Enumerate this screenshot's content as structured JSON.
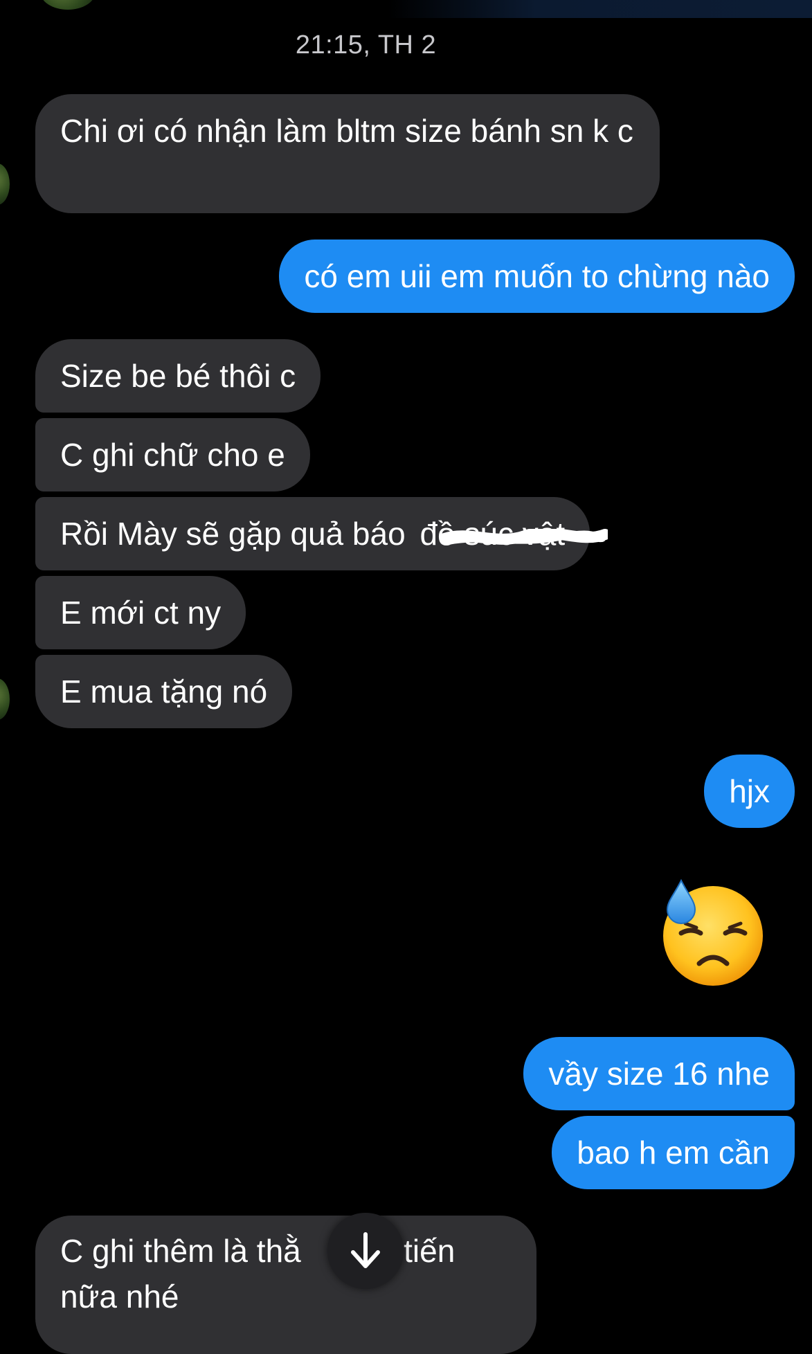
{
  "thread": {
    "timestamp": "21:15, TH 2"
  },
  "messages": [
    {
      "side": "incoming",
      "text": "Chi ơi có nhận làm bltm size bánh sn k c"
    },
    {
      "side": "outgoing",
      "text": "có em uii em muốn to chừng nào"
    },
    {
      "side": "incoming",
      "text": "Size be bé thôi c"
    },
    {
      "side": "incoming",
      "text": "C ghi chữ cho e"
    },
    {
      "side": "incoming",
      "text": "Rồi Mày sẽ gặp quả báo",
      "redacted_suffix": "đồ súc vật"
    },
    {
      "side": "incoming",
      "text": "E mới ct ny"
    },
    {
      "side": "incoming",
      "text": "E mua tặng nó"
    },
    {
      "side": "outgoing",
      "text": "hjx"
    },
    {
      "side": "outgoing",
      "emoji": "😓",
      "icon": "downcast-sweat-face-emoji"
    },
    {
      "side": "outgoing",
      "text": "vầy size 16 nhe"
    },
    {
      "side": "outgoing",
      "text": "bao h em cần"
    },
    {
      "side": "incoming",
      "text": "C ghi thêm là thằ",
      "text_after": "ó tiến",
      "text_line2": "nữa nhé"
    }
  ],
  "controls": {
    "scroll_down_icon": "arrow-down-icon"
  },
  "colors": {
    "background": "#000000",
    "incoming_bubble": "#303033",
    "outgoing_bubble": "#1e8cf3",
    "timestamp_text": "#c8c8cc"
  }
}
